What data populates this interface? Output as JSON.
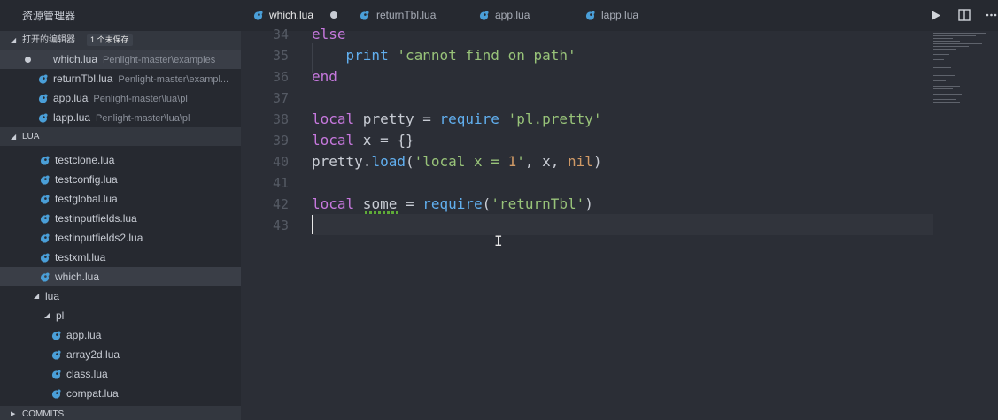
{
  "sidebar": {
    "title": "资源管理器",
    "open_editors": {
      "label": "打开的编辑器",
      "badge": "1 个未保存",
      "items": [
        {
          "name": "which.lua",
          "path": "Penlight-master\\examples"
        },
        {
          "name": "returnTbl.lua",
          "path": "Penlight-master\\exampl..."
        },
        {
          "name": "app.lua",
          "path": "Penlight-master\\lua\\pl"
        },
        {
          "name": "lapp.lua",
          "path": "Penlight-master\\lua\\pl"
        }
      ]
    },
    "project": {
      "label": "LUA",
      "files": [
        "testclone.lua",
        "testconfig.lua",
        "testglobal.lua",
        "testinputfields.lua",
        "testinputfields2.lua",
        "testxml.lua",
        "which.lua"
      ],
      "folder_lua": "lua",
      "folder_pl": "pl",
      "pl_files": [
        "app.lua",
        "array2d.lua",
        "class.lua",
        "compat.lua"
      ]
    },
    "commits_label": "COMMITS"
  },
  "tabs": [
    {
      "label": "which.lua"
    },
    {
      "label": "returnTbl.lua"
    },
    {
      "label": "app.lua"
    },
    {
      "label": "lapp.lua"
    }
  ],
  "editor": {
    "line_numbers": [
      "34",
      "35",
      "36",
      "37",
      "38",
      "39",
      "40",
      "41",
      "42",
      "43"
    ]
  },
  "icons": {
    "run": "play-icon",
    "split": "split-editor-icon",
    "more": "more-icon",
    "file": "lua-file-icon"
  },
  "colors": {
    "keyword": "#c678dd",
    "function": "#61afef",
    "string": "#98c379",
    "number": "#d19a66",
    "file_icon": "#4a9fd8"
  }
}
